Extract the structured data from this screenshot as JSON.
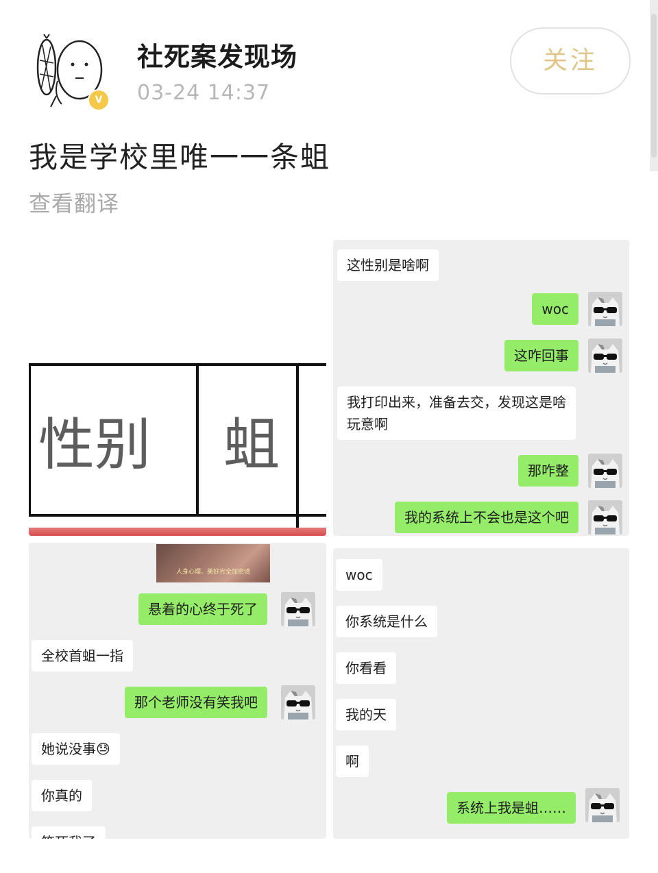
{
  "post": {
    "username": "社死案发现场",
    "timestamp": "03-24 14:37",
    "follow_label": "关注",
    "text": "我是学校里唯一一条蛆",
    "translate_label": "查看翻译",
    "verified_badge": "V"
  },
  "icons": {
    "avatar": "cartoon-face-avatar-icon",
    "verified": "verified-badge-icon",
    "chat_avatar": "cat-with-sunglasses-avatar-icon"
  },
  "colors": {
    "follow_text": "#e0c58a",
    "sent_bubble": "#95ec69",
    "received_bubble": "#ffffff",
    "chat_background": "#efefef",
    "timestamp": "#b7b7b7"
  },
  "form_image": {
    "label_gender": "性别",
    "value": "蛆"
  },
  "chat1": {
    "messages": [
      {
        "side": "left",
        "text": "这性别是啥啊"
      },
      {
        "side": "right",
        "text": "woc"
      },
      {
        "side": "right",
        "text": "这咋回事"
      },
      {
        "side": "left",
        "text": "我打印出来，准备去交，发现这是啥玩意啊"
      },
      {
        "side": "right",
        "text": "那咋整"
      },
      {
        "side": "right",
        "text": "我的系统上不会也是这个吧"
      }
    ]
  },
  "chat2": {
    "video_caption": "人身心理、美好完全加密请",
    "messages": [
      {
        "side": "right",
        "text": "悬着的心终于死了"
      },
      {
        "side": "left",
        "text": "全校首蛆一指"
      },
      {
        "side": "right",
        "text": "那个老师没有笑我吧"
      },
      {
        "side": "left",
        "text": "她说没事😓"
      },
      {
        "side": "left",
        "text": "你真的"
      },
      {
        "side": "left",
        "text": "笑死我了"
      }
    ]
  },
  "chat3": {
    "messages": [
      {
        "side": "left",
        "text": "woc"
      },
      {
        "side": "left",
        "text": "你系统是什么"
      },
      {
        "side": "left",
        "text": "你看看"
      },
      {
        "side": "left",
        "text": "我的天"
      },
      {
        "side": "left",
        "text": "啊"
      },
      {
        "side": "right",
        "text": "系统上我是蛆……"
      }
    ]
  }
}
